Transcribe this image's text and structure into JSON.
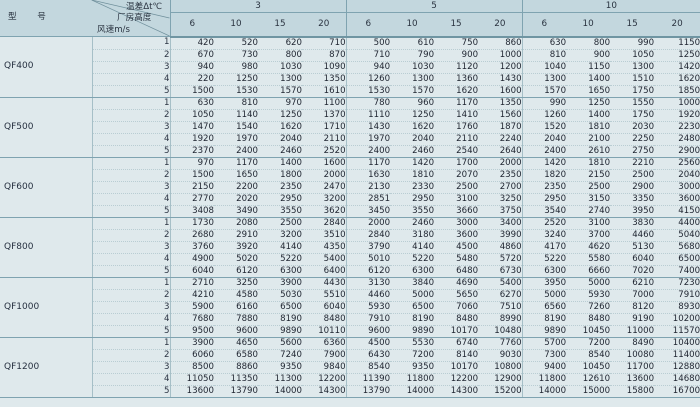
{
  "header": {
    "model_label": "型　号",
    "temp_label": "温差Δt℃",
    "height_label": "厂房高度",
    "wind_label": "风速m/s",
    "temps": [
      "3",
      "5",
      "10"
    ],
    "heights": [
      "6",
      "10",
      "15",
      "20",
      "6",
      "10",
      "15",
      "20",
      "6",
      "10",
      "15",
      "20"
    ]
  },
  "groups": [
    {
      "model": "QF400",
      "rows": [
        {
          "speed": "1",
          "values": [
            "420",
            "520",
            "620",
            "710",
            "500",
            "610",
            "750",
            "860",
            "630",
            "800",
            "990",
            "1150"
          ]
        },
        {
          "speed": "2",
          "values": [
            "670",
            "730",
            "800",
            "870",
            "710",
            "790",
            "900",
            "1000",
            "810",
            "900",
            "1050",
            "1250"
          ]
        },
        {
          "speed": "3",
          "values": [
            "940",
            "980",
            "1030",
            "1090",
            "940",
            "1030",
            "1120",
            "1200",
            "1040",
            "1150",
            "1300",
            "1420"
          ]
        },
        {
          "speed": "4",
          "values": [
            "220",
            "1250",
            "1300",
            "1350",
            "1260",
            "1300",
            "1360",
            "1430",
            "1300",
            "1400",
            "1510",
            "1620"
          ]
        },
        {
          "speed": "5",
          "values": [
            "1500",
            "1530",
            "1570",
            "1610",
            "1530",
            "1570",
            "1620",
            "1600",
            "1570",
            "1650",
            "1750",
            "1850"
          ]
        }
      ]
    },
    {
      "model": "QF500",
      "rows": [
        {
          "speed": "1",
          "values": [
            "630",
            "810",
            "970",
            "1100",
            "780",
            "960",
            "1170",
            "1350",
            "990",
            "1250",
            "1550",
            "1000"
          ]
        },
        {
          "speed": "2",
          "values": [
            "1050",
            "1140",
            "1250",
            "1370",
            "1110",
            "1250",
            "1410",
            "1560",
            "1260",
            "1400",
            "1750",
            "1920"
          ]
        },
        {
          "speed": "3",
          "values": [
            "1470",
            "1540",
            "1620",
            "1710",
            "1430",
            "1620",
            "1760",
            "1870",
            "1520",
            "1810",
            "2030",
            "2230"
          ]
        },
        {
          "speed": "4",
          "values": [
            "1920",
            "1970",
            "2040",
            "2110",
            "1970",
            "2040",
            "2110",
            "2240",
            "2040",
            "2100",
            "2250",
            "2480"
          ]
        },
        {
          "speed": "5",
          "values": [
            "2370",
            "2400",
            "2460",
            "2520",
            "2400",
            "2460",
            "2540",
            "2640",
            "2400",
            "2610",
            "2750",
            "2900"
          ]
        }
      ]
    },
    {
      "model": "QF600",
      "rows": [
        {
          "speed": "1",
          "values": [
            "970",
            "1170",
            "1400",
            "1600",
            "1170",
            "1420",
            "1700",
            "2000",
            "1420",
            "1810",
            "2210",
            "2560"
          ]
        },
        {
          "speed": "2",
          "values": [
            "1500",
            "1650",
            "1800",
            "2000",
            "1630",
            "1810",
            "2070",
            "2350",
            "1820",
            "2150",
            "2500",
            "2040"
          ]
        },
        {
          "speed": "3",
          "values": [
            "2150",
            "2200",
            "2350",
            "2470",
            "2130",
            "2330",
            "2500",
            "2700",
            "2350",
            "2500",
            "2900",
            "3000"
          ]
        },
        {
          "speed": "4",
          "values": [
            "2770",
            "2020",
            "2950",
            "3200",
            "2851",
            "2950",
            "3100",
            "3250",
            "2950",
            "3150",
            "3350",
            "3600"
          ]
        },
        {
          "speed": "5",
          "values": [
            "3408",
            "3490",
            "3550",
            "3620",
            "3450",
            "3550",
            "3660",
            "3750",
            "3540",
            "2740",
            "3950",
            "4150"
          ]
        }
      ]
    },
    {
      "model": "QF800",
      "rows": [
        {
          "speed": "1",
          "values": [
            "1730",
            "2080",
            "2500",
            "2840",
            "2000",
            "2460",
            "3000",
            "3400",
            "2520",
            "3100",
            "3830",
            "4400"
          ]
        },
        {
          "speed": "2",
          "values": [
            "2680",
            "2910",
            "3200",
            "3510",
            "2840",
            "3180",
            "3600",
            "3990",
            "3240",
            "3700",
            "4460",
            "5040"
          ]
        },
        {
          "speed": "3",
          "values": [
            "3760",
            "3920",
            "4140",
            "4350",
            "3790",
            "4140",
            "4500",
            "4860",
            "4170",
            "4620",
            "5130",
            "5680"
          ]
        },
        {
          "speed": "4",
          "values": [
            "4900",
            "5020",
            "5220",
            "5400",
            "5010",
            "5220",
            "5480",
            "5720",
            "5220",
            "5580",
            "6040",
            "6500"
          ]
        },
        {
          "speed": "5",
          "values": [
            "6040",
            "6120",
            "6300",
            "6400",
            "6120",
            "6300",
            "6480",
            "6730",
            "6300",
            "6660",
            "7020",
            "7400"
          ]
        }
      ]
    },
    {
      "model": "QF1000",
      "rows": [
        {
          "speed": "1",
          "values": [
            "2710",
            "3250",
            "3900",
            "4430",
            "3130",
            "3840",
            "4690",
            "5400",
            "3950",
            "5000",
            "6210",
            "7230"
          ]
        },
        {
          "speed": "2",
          "values": [
            "4210",
            "4580",
            "5030",
            "5510",
            "4460",
            "5000",
            "5650",
            "6270",
            "5000",
            "5930",
            "7000",
            "7910"
          ]
        },
        {
          "speed": "3",
          "values": [
            "5900",
            "6160",
            "6500",
            "6040",
            "5930",
            "6500",
            "7060",
            "7510",
            "6560",
            "7260",
            "8120",
            "8930"
          ]
        },
        {
          "speed": "4",
          "values": [
            "7680",
            "7880",
            "8190",
            "8480",
            "7910",
            "8190",
            "8480",
            "8990",
            "8190",
            "8480",
            "9190",
            "10200"
          ]
        },
        {
          "speed": "5",
          "values": [
            "9500",
            "9600",
            "9890",
            "10110",
            "9600",
            "9890",
            "10170",
            "10480",
            "9890",
            "10450",
            "11000",
            "11570"
          ]
        }
      ]
    },
    {
      "model": "QF1200",
      "rows": [
        {
          "speed": "1",
          "values": [
            "3900",
            "4650",
            "5600",
            "6360",
            "4500",
            "5530",
            "6740",
            "7760",
            "5700",
            "7200",
            "8490",
            "10400"
          ]
        },
        {
          "speed": "2",
          "values": [
            "6060",
            "6580",
            "7240",
            "7900",
            "6430",
            "7200",
            "8140",
            "9030",
            "7300",
            "8540",
            "10080",
            "11400"
          ]
        },
        {
          "speed": "3",
          "values": [
            "8500",
            "8860",
            "9350",
            "9840",
            "8540",
            "9350",
            "10170",
            "10800",
            "9400",
            "10450",
            "11700",
            "12880"
          ]
        },
        {
          "speed": "4",
          "values": [
            "11050",
            "11350",
            "11300",
            "12200",
            "11390",
            "11800",
            "12200",
            "12900",
            "11800",
            "12610",
            "13600",
            "14680"
          ]
        },
        {
          "speed": "5",
          "values": [
            "13600",
            "13790",
            "14000",
            "14300",
            "13790",
            "14000",
            "14300",
            "15200",
            "14000",
            "15000",
            "15800",
            "16700"
          ]
        }
      ]
    }
  ]
}
